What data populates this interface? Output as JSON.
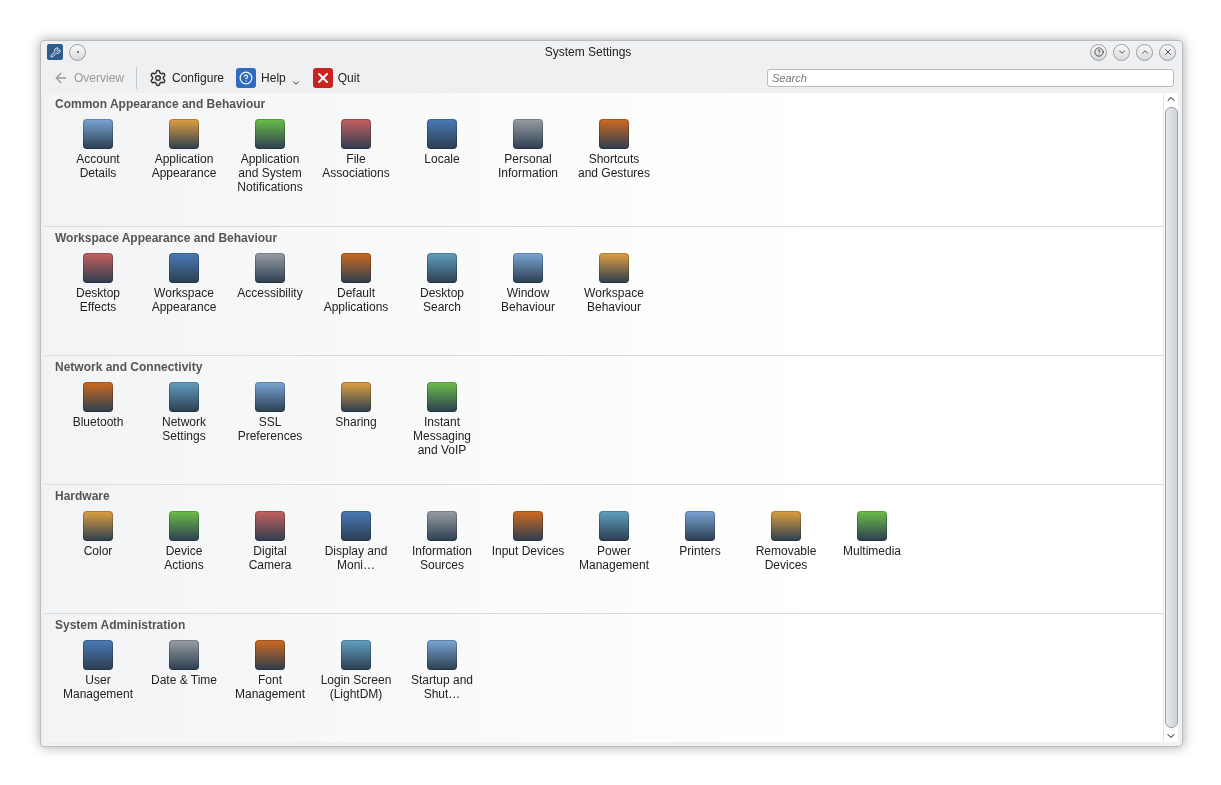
{
  "window": {
    "title": "System Settings"
  },
  "toolbar": [
    {
      "label": "Overview",
      "kind": "back",
      "disabled": true
    },
    {
      "label": "Configure",
      "kind": "gear",
      "disabled": false
    },
    {
      "label": "Help",
      "kind": "help",
      "disabled": false
    },
    {
      "label": "Quit",
      "kind": "quit",
      "disabled": false
    }
  ],
  "search": {
    "placeholder": "Search"
  },
  "sections": [
    {
      "title": "Common Appearance and Behaviour",
      "items": [
        "Account Details",
        "Application Appearance",
        "Application and System Notifications",
        "File Associations",
        "Locale",
        "Personal Information",
        "Shortcuts and Gestures"
      ]
    },
    {
      "title": "Workspace Appearance and Behaviour",
      "items": [
        "Desktop Effects",
        "Workspace Appearance",
        "Accessibility",
        "Default Applications",
        "Desktop Search",
        "Window Behaviour",
        "Workspace Behaviour"
      ]
    },
    {
      "title": "Network and Connectivity",
      "items": [
        "Bluetooth",
        "Network Settings",
        "SSL Preferences",
        "Sharing",
        "Instant Messaging and VoIP"
      ]
    },
    {
      "title": "Hardware",
      "items": [
        "Color",
        "Device Actions",
        "Digital Camera",
        "Display and Moni…",
        "Information Sources",
        "Input Devices",
        "Power Management",
        "Printers",
        "Removable Devices",
        "Multimedia"
      ]
    },
    {
      "title": "System Administration",
      "items": [
        "User Management",
        "Date & Time",
        "Font Management",
        "Login Screen (LightDM)",
        "Startup and Shut…"
      ]
    }
  ]
}
